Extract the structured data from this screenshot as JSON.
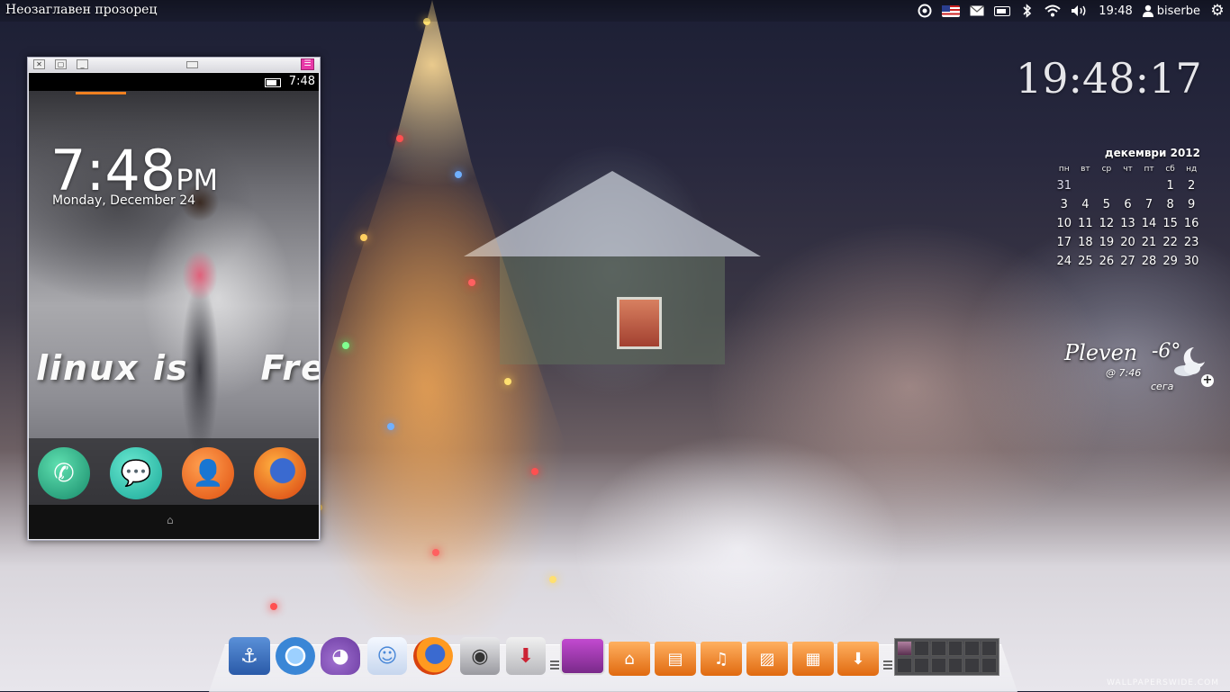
{
  "top_panel": {
    "window_title": "Неозаглавен прозорец",
    "clock": "19:48",
    "user": "biserbe",
    "icons": [
      "ubuntu-one-icon",
      "keyboard-layout-flag-icon",
      "mail-icon",
      "battery-icon",
      "bluetooth-icon",
      "wifi-icon",
      "volume-icon",
      "user-icon",
      "settings-gear-icon"
    ]
  },
  "phone_window": {
    "statusbar_time": "7:48",
    "lock_time": "7:48",
    "lock_ampm": "PM",
    "lock_date": "Monday, December 24",
    "wallpaper_text_1": "linux is",
    "wallpaper_text_2": "Freed",
    "dock_apps": [
      "phone-app-icon",
      "messages-app-icon",
      "contacts-app-icon",
      "firefox-app-icon"
    ],
    "home_glyph": "⌂"
  },
  "desktop_clock": "19:48:17",
  "calendar": {
    "title": "декември 2012",
    "weekdays": [
      "пн",
      "вт",
      "ср",
      "чт",
      "пт",
      "сб",
      "нд"
    ],
    "weeks": [
      [
        "31",
        "",
        "",
        "",
        "",
        "1",
        "2"
      ],
      [
        "3",
        "4",
        "5",
        "6",
        "7",
        "8",
        "9"
      ],
      [
        "10",
        "11",
        "12",
        "13",
        "14",
        "15",
        "16"
      ],
      [
        "17",
        "18",
        "19",
        "20",
        "21",
        "22",
        "23"
      ],
      [
        "24",
        "25",
        "26",
        "27",
        "28",
        "29",
        "30"
      ]
    ]
  },
  "weather": {
    "city": "Pleven",
    "temperature": "-6°",
    "updated": "@ 7:46",
    "label": "сега",
    "icon": "moon-cloud-icon"
  },
  "dock": {
    "items": [
      "anchor-icon",
      "chromium-icon",
      "pidgin-icon",
      "empathy-icon",
      "firefox-icon",
      "camera-icon",
      "installer-icon",
      "monitor-icon",
      "home-folder-icon",
      "documents-folder-icon",
      "music-folder-icon",
      "pictures-folder-icon",
      "videos-folder-icon",
      "downloads-folder-icon"
    ]
  },
  "watermark": "WALLPAPERSWIDE.COM"
}
